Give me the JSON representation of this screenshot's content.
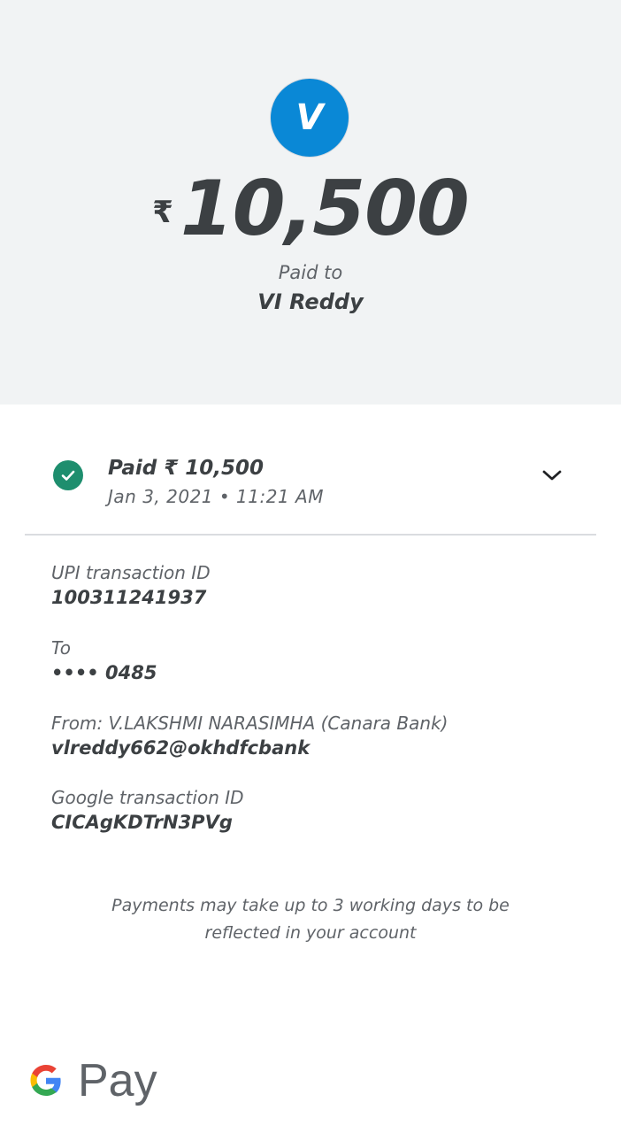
{
  "header": {
    "avatar_initial": "V",
    "currency_symbol": "₹",
    "amount": "10,500",
    "paid_to_label": "Paid to",
    "payee_name": "VI Reddy"
  },
  "status": {
    "icon": "check-circle-icon",
    "title": "Paid ₹ 10,500",
    "datetime": "Jan 3, 2021 • 11:21 AM",
    "expand_icon": "chevron-down-icon"
  },
  "details": {
    "upi_label": "UPI transaction ID",
    "upi_value": "100311241937",
    "to_label": "To",
    "to_value": "•••• 0485",
    "from_label": "From: V.LAKSHMI NARASIMHA (Canara Bank)",
    "from_value": "vlreddy662@okhdfcbank",
    "google_label": "Google transaction ID",
    "google_value": "CICAgKDTrN3PVg"
  },
  "footer": {
    "note_line1": "Payments may take up to 3 working days to be",
    "note_line2": "reflected in your account",
    "brand": "Pay"
  },
  "colors": {
    "avatar_bg": "#0a88d6",
    "success_green": "#1e8e6e",
    "header_bg": "#f1f3f4",
    "text_dark": "#3c4043",
    "text_muted": "#5f6368"
  }
}
